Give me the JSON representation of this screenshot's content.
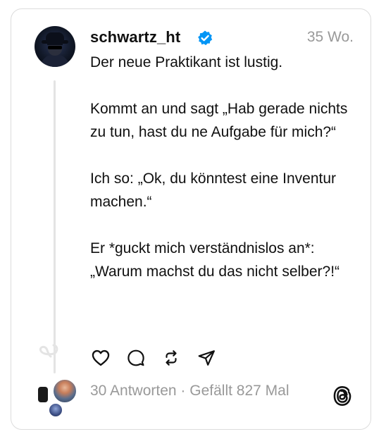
{
  "post": {
    "username": "schwartz_ht",
    "verified": true,
    "time": "35 Wo.",
    "text": "Der neue Praktikant ist lustig.\n\nKommt an und sagt „Hab gerade nichts zu tun, hast du ne Aufgabe für mich?“\n\nIch so: „Ok, du könntest eine Inventur machen.“\n\nEr *guckt mich verständnislos an*: „Warum machst du das nicht selber?!“"
  },
  "actions": [
    "heart-icon",
    "comment-icon",
    "repost-icon",
    "share-icon"
  ],
  "stats": {
    "replies": "30 Antworten",
    "separator": " · ",
    "likes": "Gefällt 827 Mal"
  },
  "colors": {
    "text": "#101010",
    "secondary": "#999999",
    "verified": "#0095f6",
    "border": "#dcdcdc",
    "thread_line": "#e4e4e4"
  }
}
